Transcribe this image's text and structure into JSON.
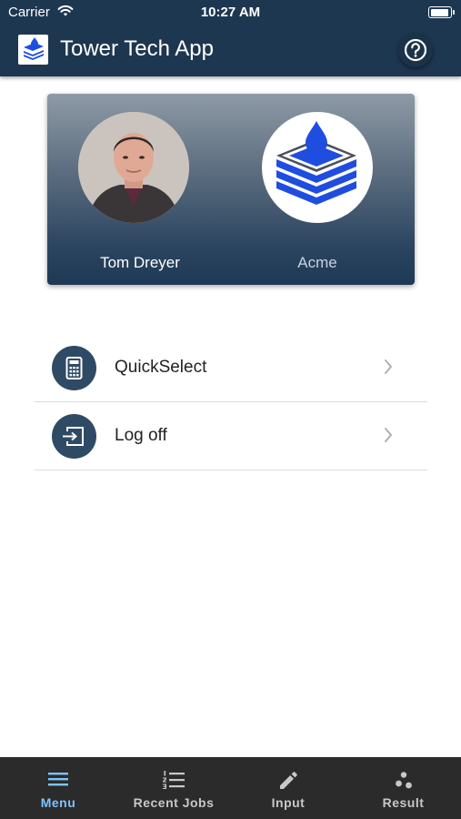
{
  "status_bar": {
    "carrier": "Carrier",
    "time": "10:27 AM"
  },
  "app_bar": {
    "title": "Tower Tech App",
    "logo_icon": "tower-tech-logo-icon",
    "help_icon": "help-circle-icon"
  },
  "profile": {
    "user_name": "Tom Dreyer",
    "company_name": "Acme"
  },
  "menu": {
    "items": [
      {
        "label": "QuickSelect",
        "icon": "calculator-icon"
      },
      {
        "label": "Log off",
        "icon": "log-off-icon"
      }
    ]
  },
  "bottom_nav": {
    "items": [
      {
        "label": "Menu",
        "icon": "menu-icon",
        "active": true
      },
      {
        "label": "Recent Jobs",
        "icon": "numbered-list-icon",
        "active": false
      },
      {
        "label": "Input",
        "icon": "pencil-icon",
        "active": false
      },
      {
        "label": "Result",
        "icon": "bubbles-icon",
        "active": false
      }
    ]
  },
  "colors": {
    "app_bar": "#1e3750",
    "accent": "#7cc4ff",
    "nav_bg": "#2b2b2b",
    "logo_blue": "#1f4de0"
  }
}
